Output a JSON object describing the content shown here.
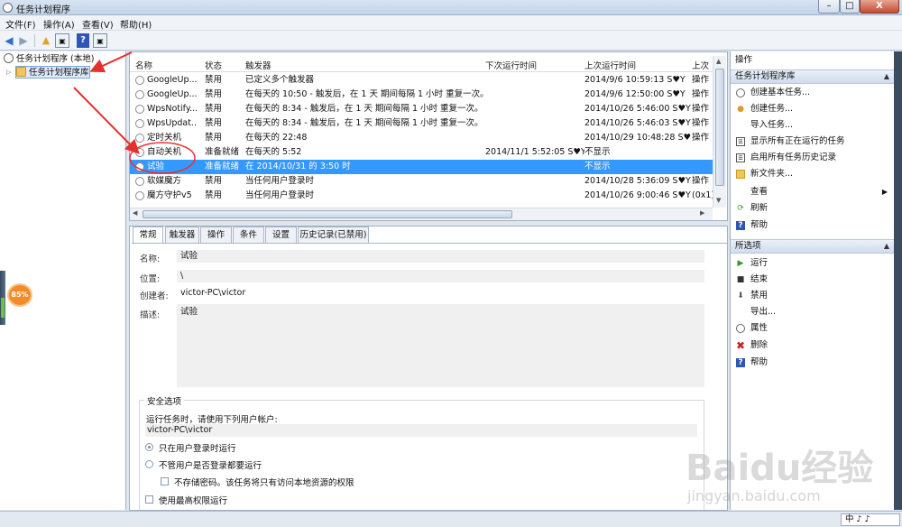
{
  "window": {
    "title": "任务计划程序",
    "min": "–",
    "max": "□",
    "close": "X"
  },
  "menu": [
    "文件(F)",
    "操作(A)",
    "查看(V)",
    "帮助(H)"
  ],
  "toolbar": {
    "back_icon": "arrow-left",
    "forward_icon": "arrow-right",
    "help_label": "?"
  },
  "tree": {
    "root": "任务计划程序 (本地)",
    "library": "任务计划程序库"
  },
  "tray_badge": "85%",
  "task_list": {
    "columns": [
      "名称",
      "状态",
      "触发器",
      "下次运行时间",
      "上次运行时间",
      "上次"
    ],
    "rows": [
      {
        "name": "GoogleUp...",
        "status": "禁用",
        "trigger": "已定义多个触发器",
        "next": "",
        "last": "2014/9/6 10:59:13 S♥Y",
        "last2": "操作"
      },
      {
        "name": "GoogleUp...",
        "status": "禁用",
        "trigger": "在每天的 10:50 - 触发后，在 1 天 期间每隔 1 小时 重复一次。",
        "next": "",
        "last": "2014/9/6 12:50:00 S♥Y",
        "last2": "操作"
      },
      {
        "name": "WpsNotify...",
        "status": "禁用",
        "trigger": "在每天的 8:34 - 触发后，在 1 天 期间每隔 1 小时 重复一次。",
        "next": "",
        "last": "2014/10/26 5:46:00 S♥Y",
        "last2": "操作"
      },
      {
        "name": "WpsUpdat...",
        "status": "禁用",
        "trigger": "在每天的 8:34 - 触发后，在 1 天 期间每隔 1 小时 重复一次。",
        "next": "",
        "last": "2014/10/26 5:46:03 S♥Y",
        "last2": "操作"
      },
      {
        "name": "定时关机",
        "status": "禁用",
        "trigger": "在每天的 22:48",
        "next": "",
        "last": "2014/10/29 10:48:28 S♥Y",
        "last2": "操作"
      },
      {
        "name": "自动关机",
        "status": "准备就绪",
        "trigger": "在每天的 5:52",
        "next": "2014/11/1 5:52:05 S♥Y",
        "last": "不显示",
        "last2": ""
      },
      {
        "name": "试验",
        "status": "准备就绪",
        "trigger": "在 2014/10/31 的 3:50 时",
        "next": "",
        "last": "不显示",
        "last2": "",
        "selected": true
      },
      {
        "name": "软媒魔方",
        "status": "禁用",
        "trigger": "当任何用户登录时",
        "next": "",
        "last": "2014/10/28 5:36:09 S♥Y",
        "last2": "操作"
      },
      {
        "name": "魔方守护v5",
        "status": "禁用",
        "trigger": "当任何用户登录时",
        "next": "",
        "last": "2014/10/26 9:00:46 S♥Y",
        "last2": "(0x1)"
      }
    ]
  },
  "detail_tabs": [
    "常规",
    "触发器",
    "操作",
    "条件",
    "设置",
    "历史记录(已禁用)"
  ],
  "general": {
    "name_label": "名称:",
    "name_value": "试验",
    "location_label": "位置:",
    "location_value": "\\",
    "author_label": "创建者:",
    "author_value": "victor-PC\\victor",
    "desc_label": "描述:",
    "desc_value": "试验"
  },
  "security": {
    "legend": "安全选项",
    "run_as_text": "运行任务时，请使用下列用户帐户:",
    "account": "victor-PC\\victor",
    "opt_logged_on": "只在用户登录时运行",
    "opt_any": "不管用户是否登录都要运行",
    "opt_nopass": "不存储密码。该任务将只有访问本地资源的权限",
    "opt_highest": "使用最高权限运行"
  },
  "actions_pane": {
    "title": "操作",
    "section1": "任务计划程序库",
    "items1": [
      "创建基本任务...",
      "创建任务...",
      "导入任务...",
      "显示所有正在运行的任务",
      "启用所有任务历史记录",
      "新文件夹...",
      "查看",
      "刷新",
      "帮助"
    ],
    "section2": "所选项",
    "items2": [
      "运行",
      "结束",
      "禁用",
      "导出...",
      "属性",
      "删除",
      "帮助"
    ]
  },
  "ime": "中 ♪ ♪",
  "watermark": "Baidu经验",
  "watermark_url": "jingyan.baidu.com",
  "annotation_color": "#e53030",
  "selection_color": "#3399ff"
}
